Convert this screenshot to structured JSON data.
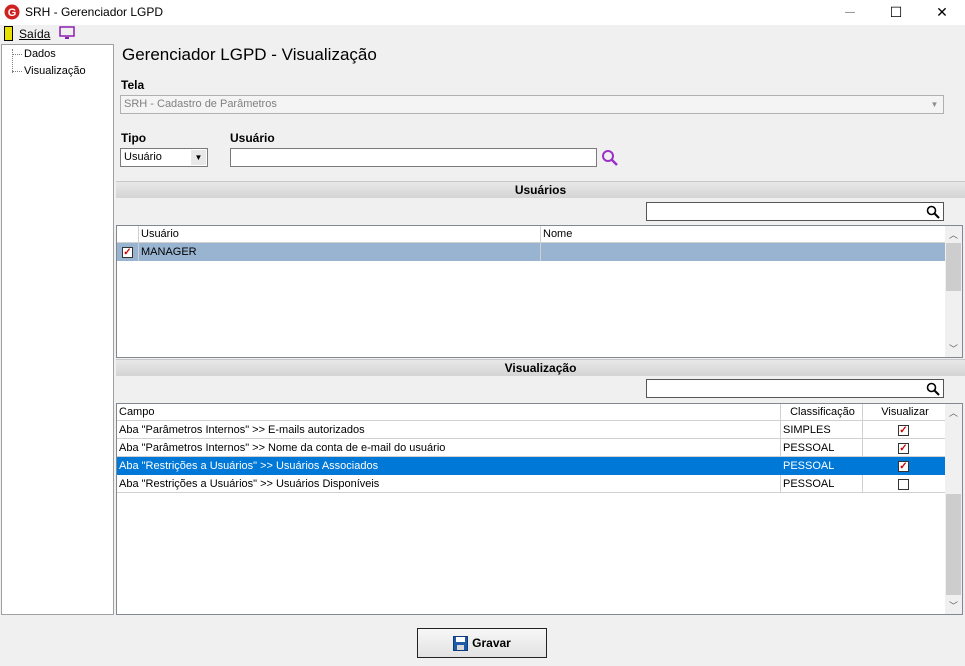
{
  "window": {
    "title": "SRH - Gerenciador LGPD",
    "minimize": "—",
    "maximize": "☐",
    "close": "✕"
  },
  "menu": {
    "exit_label": "Saída"
  },
  "tree": {
    "items": [
      "Dados",
      "Visualização"
    ]
  },
  "page": {
    "title": "Gerenciador LGPD - Visualização"
  },
  "tela": {
    "label": "Tela",
    "value": "SRH - Cadastro de Parâmetros"
  },
  "tipo": {
    "label": "Tipo",
    "value": "Usuário"
  },
  "usuario": {
    "label": "Usuário",
    "value": ""
  },
  "users_section": {
    "title": "Usuários",
    "search_value": "",
    "columns": [
      "Usuário",
      "Nome"
    ],
    "rows": [
      {
        "checked": true,
        "usuario": "MANAGER",
        "nome": ""
      }
    ]
  },
  "view_section": {
    "title": "Visualização",
    "search_value": "",
    "columns": [
      "Campo",
      "Classificação",
      "Visualizar"
    ],
    "rows": [
      {
        "campo": "Aba \"Parâmetros Internos\" >> E-mails autorizados",
        "classificacao": "SIMPLES",
        "visualizar": true
      },
      {
        "campo": "Aba \"Parâmetros Internos\" >> Nome da conta de e-mail do usuário",
        "classificacao": "PESSOAL",
        "visualizar": true
      },
      {
        "campo": "Aba \"Restrições a Usuários\" >> Usuários Associados",
        "classificacao": "PESSOAL",
        "visualizar": true
      },
      {
        "campo": "Aba \"Restrições a Usuários\" >> Usuários Disponíveis",
        "classificacao": "PESSOAL",
        "visualizar": false
      }
    ]
  },
  "buttons": {
    "save_label": "Gravar"
  },
  "colors": {
    "selected_row": "#0078d7",
    "manager_row": "#99b4d1",
    "search_icon": "#9b30c8"
  }
}
